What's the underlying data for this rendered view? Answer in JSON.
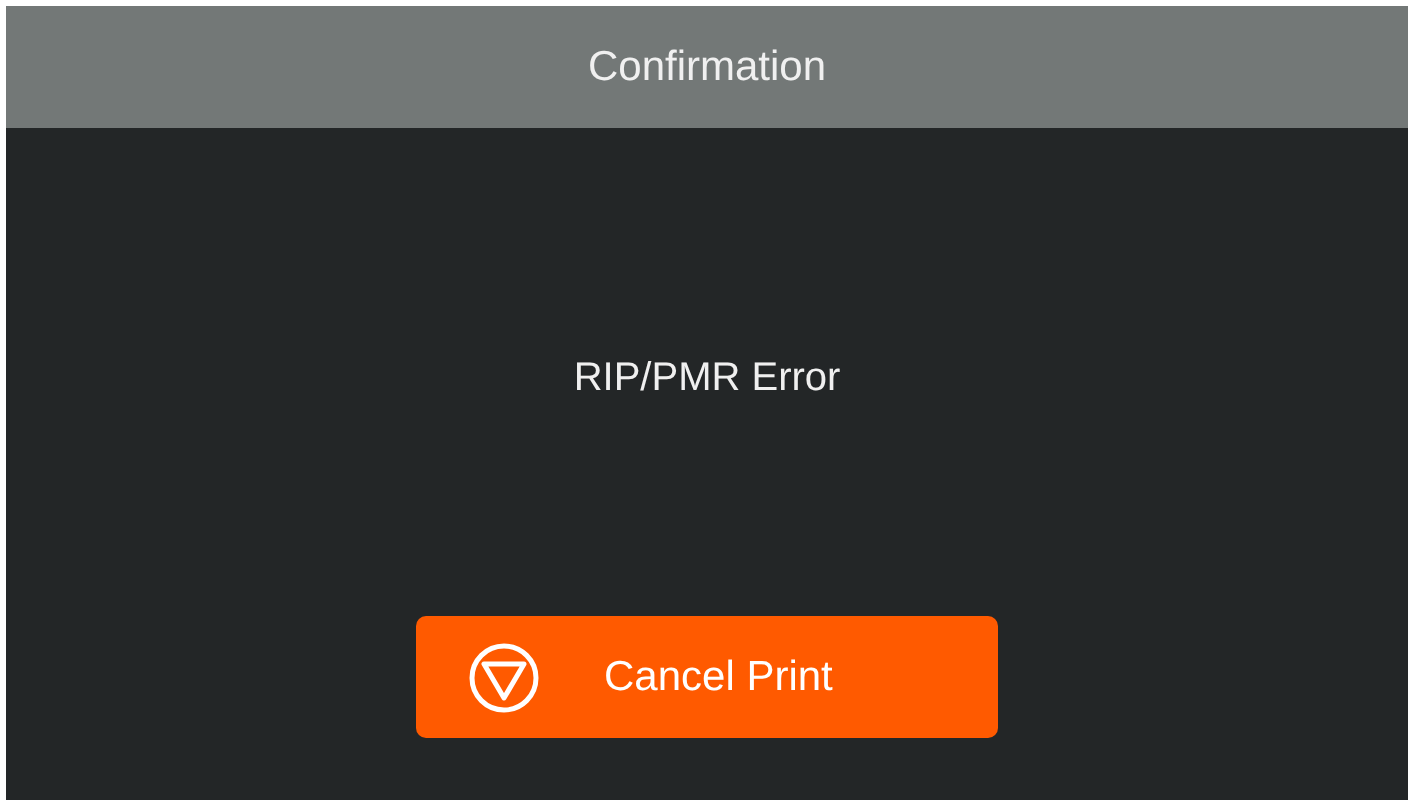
{
  "header": {
    "title": "Confirmation"
  },
  "message": "RIP/PMR Error",
  "buttons": [
    {
      "label": "Cancel Print"
    }
  ]
}
